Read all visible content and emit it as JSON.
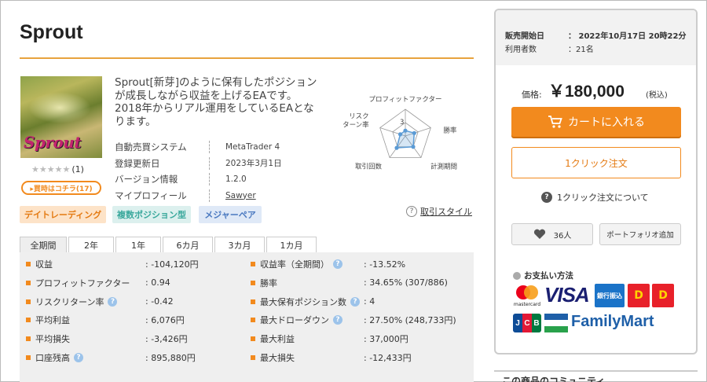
{
  "product": {
    "title": "Sprout",
    "image_logo": "Sprout",
    "rating_count": "(1)",
    "buyer_badge": "▸買時はコチラ(17)",
    "description": "Sprout[新芽]のように保有したポジションが成長しながら収益を上げるEAです。2018年からリアル運用をしているEAとなります。",
    "info": [
      {
        "key": "自動売買システム",
        "value": "MetaTrader 4"
      },
      {
        "key": "登録更新日",
        "value": "2023年3月1日"
      },
      {
        "key": "バージョン情報",
        "value": "1.2.0"
      },
      {
        "key": "マイプロフィール",
        "value": "Sawyer"
      }
    ],
    "tags": [
      "デイトレーディング",
      "複数ポジション型",
      "メジャーペア"
    ],
    "trade_style_link": "取引スタイル"
  },
  "radar": {
    "labels": [
      "プロフィットファクター",
      "勝率",
      "計測期間",
      "取引回数",
      "リスクターン率"
    ],
    "label_lines": [
      [
        "プロフィットファクター"
      ],
      [
        "勝率"
      ],
      [
        "計測期間"
      ],
      [
        "取引回数"
      ],
      [
        "リスク",
        "ターン率"
      ]
    ],
    "scale_label": "3",
    "values": [
      0.2,
      0.35,
      0.5,
      0.55,
      0.2
    ],
    "color": "#5b9bd5"
  },
  "tabs": [
    "全期間",
    "2年",
    "1年",
    "6カ月",
    "3カ月",
    "1カ月"
  ],
  "stats_left": [
    {
      "label": "収益",
      "value": ": -104,120円",
      "help": false
    },
    {
      "label": "プロフィットファクター",
      "value": ": 0.94",
      "help": false
    },
    {
      "label": "リスクリターン率",
      "value": ": -0.42",
      "help": true
    },
    {
      "label": "平均利益",
      "value": ": 6,076円",
      "help": false
    },
    {
      "label": "平均損失",
      "value": ": -3,426円",
      "help": false
    },
    {
      "label": "口座残高",
      "value": ": 895,880円",
      "help": true
    }
  ],
  "stats_right": [
    {
      "label": "収益率（全期間）",
      "value": ": -13.52%",
      "help": true
    },
    {
      "label": "勝率",
      "value": ": 34.65% (307/886)",
      "help": false
    },
    {
      "label": "最大保有ポジション数",
      "value": ": 4",
      "help": true
    },
    {
      "label": "最大ドローダウン",
      "value": ": 27.50% (248,733円)",
      "help": true
    },
    {
      "label": "最大利益",
      "value": ": 37,000円",
      "help": false
    },
    {
      "label": "最大損失",
      "value": ": -12,433円",
      "help": false
    }
  ],
  "panel": {
    "release_key": "販売開始日",
    "release_value": "：  2022年10月17日 20時22分",
    "users_key": "利用者数",
    "users_value": "：21名",
    "price_label": "価格:",
    "price": "￥180,000",
    "tax": "(税込)",
    "cart_button": "カートに入れる",
    "oneclick_button": "1クリック注文",
    "oneclick_about": "1クリック注文について",
    "like_count": "36人",
    "portfolio_button": "ポートフォリオ追加",
    "payment_title": "お支払い方法",
    "visa": "VISA",
    "mastercard": "mastercard",
    "ginko": "銀行振込",
    "familymart": "FamilyMart",
    "jcb": "JCB",
    "community": "この商品のコミュニティ"
  },
  "colors": {
    "accent": "#f28a1e",
    "gold_rule": "#e8a33d",
    "help_blue": "#9cc3ea"
  }
}
